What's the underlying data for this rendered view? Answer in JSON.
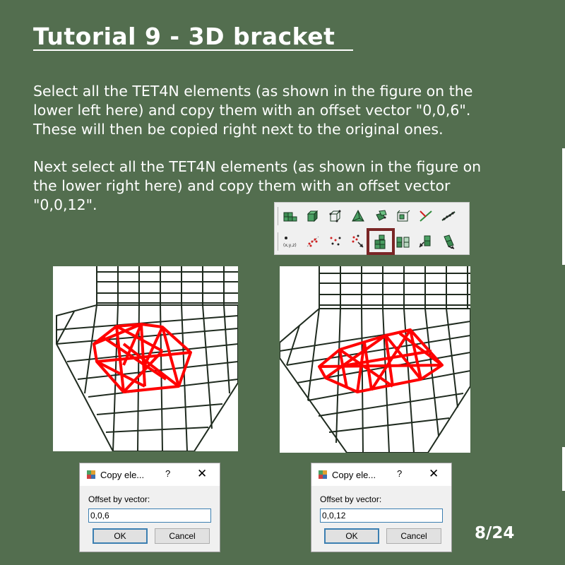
{
  "title": "Tutorial 9 - 3D bracket",
  "paragraph1": "Select all the TET4N elements (as shown in the figure on the\nlower left here) and copy them with an offset vector \"0,0,6\".\nThese will then be copied right next to the original ones.",
  "paragraph2": "Next select all the TET4N elements (as shown in the figure on\nthe lower right here) and copy them with an offset vector\n\"0,0,12\".",
  "toolbar": {
    "row1_icons": [
      "mesh-elements-icon",
      "cube-icon",
      "hex-element-icon",
      "tet-element-icon",
      "element-green-icon",
      "element-frame-icon",
      "axis-icon",
      "line-mesh-icon"
    ],
    "row2_icons": [
      "node-xyz-icon",
      "copy-nodes-icon",
      "scatter-nodes-icon",
      "move-nodes-icon",
      "copy-elements-icon",
      "mirror-elements-icon",
      "move-elements-icon",
      "rotate-elements-icon"
    ],
    "active_icon": "copy-elements-icon",
    "node_label": "(x,y,z)"
  },
  "dialog_left": {
    "title": "Copy ele...",
    "help": "?",
    "close": "✕",
    "label": "Offset by vector:",
    "value": "0,0,6",
    "ok": "OK",
    "cancel": "Cancel"
  },
  "dialog_right": {
    "title": "Copy ele...",
    "help": "?",
    "close": "✕",
    "label": "Offset by vector:",
    "value": "0,0,12",
    "ok": "OK",
    "cancel": "Cancel"
  },
  "page_number": "8/24",
  "colors": {
    "background": "#536e4f",
    "mesh_lines": "#1f2b1f",
    "highlight_elements": "#ff0000",
    "active_icon_border": "#7a2626"
  }
}
